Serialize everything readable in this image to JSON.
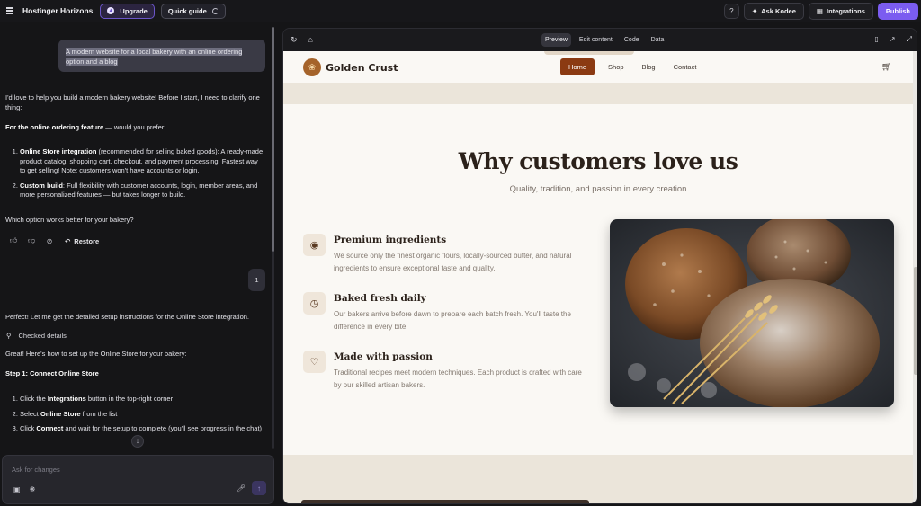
{
  "topbar": {
    "app_title": "Hostinger Horizons",
    "upgrade_label": "Upgrade",
    "quick_guide_label": "Quick guide",
    "ask_kodee_label": "Ask Kodee",
    "integrations_label": "Integrations",
    "publish_label": "Publish"
  },
  "chat": {
    "user_prompt": "A modern website for a local bakery with an online ordering option and a blog",
    "assistant_intro": "I'd love to help you build a modern bakery website! Before I start, I need to clarify one thing:",
    "question_bold": "For the online ordering feature",
    "question_rest": " — would you prefer:",
    "options": [
      {
        "bold": "Online Store integration",
        "text": " (recommended for selling baked goods): A ready-made product catalog, shopping cart, checkout, and payment processing. Fastest way to get selling! Note: customers won't have accounts or login."
      },
      {
        "bold": "Custom build",
        "text": ": Full flexibility with customer accounts, login, member areas, and more personalized features — but takes longer to build."
      }
    ],
    "follow_up": "Which option works better for your bakery?",
    "restore_label": "Restore",
    "user_reply": "1",
    "reply_1": "Perfect! Let me get the detailed setup instructions for the Online Store integration.",
    "checked_details": "Checked details",
    "reply_2": "Great! Here's how to set up the Online Store for your bakery:",
    "step_title": "Step 1: Connect Online Store",
    "steps": [
      {
        "pre": "Click the ",
        "bold": "Integrations",
        "post": " button in the top-right corner"
      },
      {
        "pre": "Select ",
        "bold": "Online Store",
        "post": " from the list"
      },
      {
        "pre": "Click ",
        "bold": "Connect",
        "post": " and wait for the setup to complete (you'll see progress in the chat)"
      }
    ],
    "composer_placeholder": "Ask for changes"
  },
  "preview_toolbar": {
    "tabs": [
      "Preview",
      "Edit content",
      "Code",
      "Data"
    ],
    "active_tab": "Preview"
  },
  "site": {
    "brand": "Golden Crust",
    "nav": [
      "Home",
      "Shop",
      "Blog",
      "Contact"
    ],
    "heading": "Why customers love us",
    "subheading": "Quality, tradition, and passion in every creation",
    "features": [
      {
        "icon": "award-icon",
        "title": "Premium ingredients",
        "text": "We source only the finest organic flours, locally-sourced butter, and natural ingredients to ensure exceptional taste and quality."
      },
      {
        "icon": "clock-icon",
        "title": "Baked fresh daily",
        "text": "Our bakers arrive before dawn to prepare each batch fresh. You'll taste the difference in every bite."
      },
      {
        "icon": "heart-icon",
        "title": "Made with passion",
        "text": "Traditional recipes meet modern techniques. Each product is crafted with care by our skilled artisan bakers."
      }
    ]
  }
}
